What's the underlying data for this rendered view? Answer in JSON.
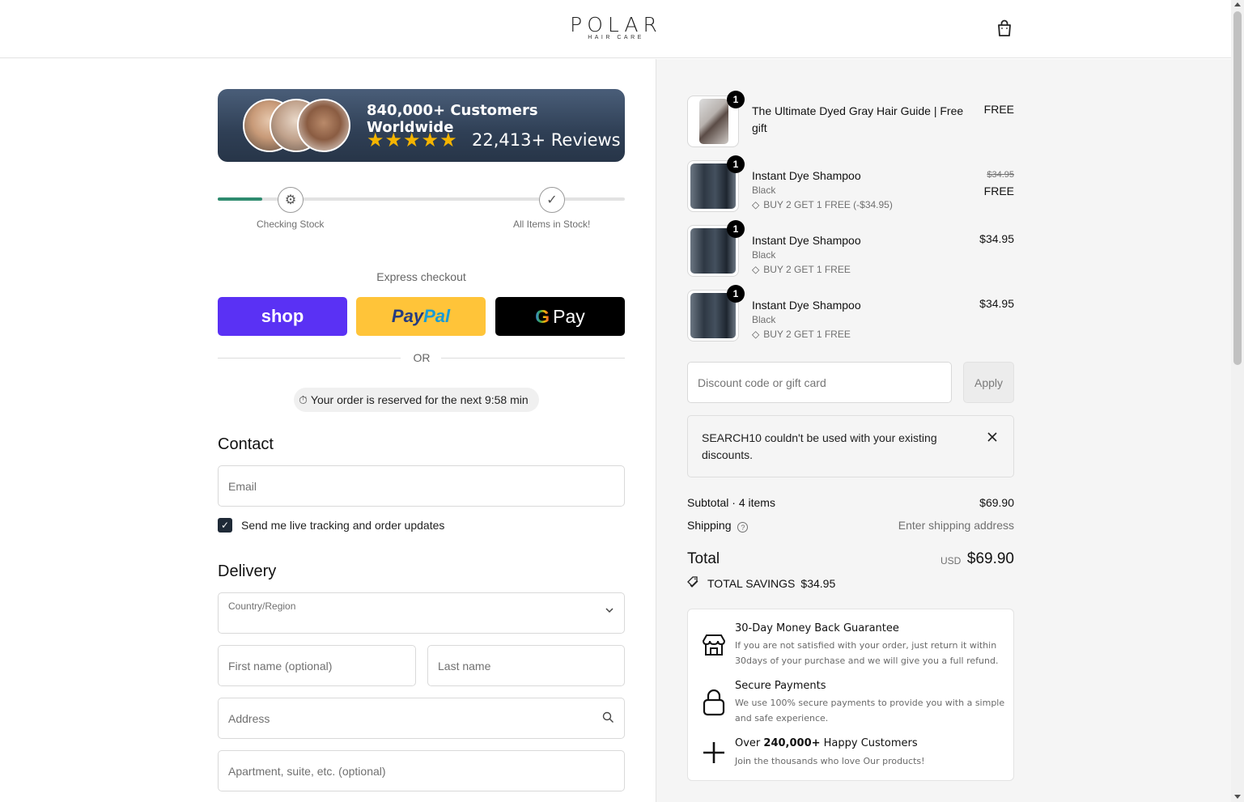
{
  "header": {
    "logo_main": "POLAR",
    "logo_sub": "HAIR CARE",
    "cart_icon": "shopping-bag-icon"
  },
  "banner": {
    "title": "840,000+ Customers Worldwide",
    "stars": "★★★★★",
    "rating": 5,
    "reviews": "22,413+ Reviews"
  },
  "stock_progress": {
    "progress": 0.11,
    "steps": [
      {
        "label": "Checking Stock",
        "icon": "gear-icon"
      },
      {
        "label": "All Items in Stock!",
        "icon": "checkmark-icon"
      }
    ]
  },
  "express": {
    "title": "Express checkout",
    "shop_label": "shop",
    "paypal_label": "PayPal",
    "gpay_label": "Pay",
    "or_label": "OR"
  },
  "timer": {
    "text": "Your order is reserved for the next 9:58 min"
  },
  "contact": {
    "title": "Contact",
    "email_placeholder": "Email",
    "tracking_label": "Send me live tracking and order updates",
    "tracking_checked": true
  },
  "delivery": {
    "title": "Delivery",
    "country_label": "Country/Region",
    "country_value": "",
    "first_name_placeholder": "First name (optional)",
    "last_name_placeholder": "Last name",
    "address_placeholder": "Address",
    "apartment_placeholder": "Apartment, suite, etc. (optional)"
  },
  "cart": {
    "items": [
      {
        "qty": "1",
        "title": "The Ultimate Dyed Gray Hair Guide | Free gift",
        "variant": "",
        "discount": "",
        "price": "FREE",
        "old_price": ""
      },
      {
        "qty": "1",
        "title": "Instant Dye Shampoo",
        "variant": "Black",
        "discount": "BUY 2 GET 1 FREE (-$34.95)",
        "price": "FREE",
        "old_price": "$34.95"
      },
      {
        "qty": "1",
        "title": "Instant Dye Shampoo",
        "variant": "Black",
        "discount": "BUY 2 GET 1 FREE",
        "price": "$34.95",
        "old_price": ""
      },
      {
        "qty": "1",
        "title": "Instant Dye Shampoo",
        "variant": "Black",
        "discount": "BUY 2 GET 1 FREE",
        "price": "$34.95",
        "old_price": ""
      }
    ],
    "discount_placeholder": "Discount code or gift card",
    "apply_label": "Apply",
    "notice": "SEARCH10 couldn't be used with your existing discounts."
  },
  "summary": {
    "subtotal_label": "Subtotal · 4 items",
    "subtotal_value": "$69.90",
    "shipping_label": "Shipping",
    "shipping_value": "Enter shipping address",
    "total_label": "Total",
    "total_currency": "USD",
    "total_value": "$69.90",
    "savings_label": "TOTAL SAVINGS",
    "savings_value": "$34.95"
  },
  "guarantees": [
    {
      "title": "30-Day Money Back Guarantee",
      "desc": "If you are not satisfied with your order, just return it within 30days of your purchase and we will give you a full refund.",
      "icon": "store-icon"
    },
    {
      "title": "Secure Payments",
      "desc": "We use 100% secure payments to provide you with a simple and safe experience.",
      "icon": "lock-icon"
    },
    {
      "title_prefix": "Over ",
      "title_bold": "240,000+",
      "title_suffix": " Happy Customers",
      "desc": "Join the thousands who love Our products!",
      "icon": "plus-icon"
    }
  ],
  "colors": {
    "progress": "#2e8b6f",
    "shop": "#5a31f4",
    "paypal": "#ffc439",
    "gpay": "#000000",
    "summary_bg": "#f5f5f5"
  }
}
